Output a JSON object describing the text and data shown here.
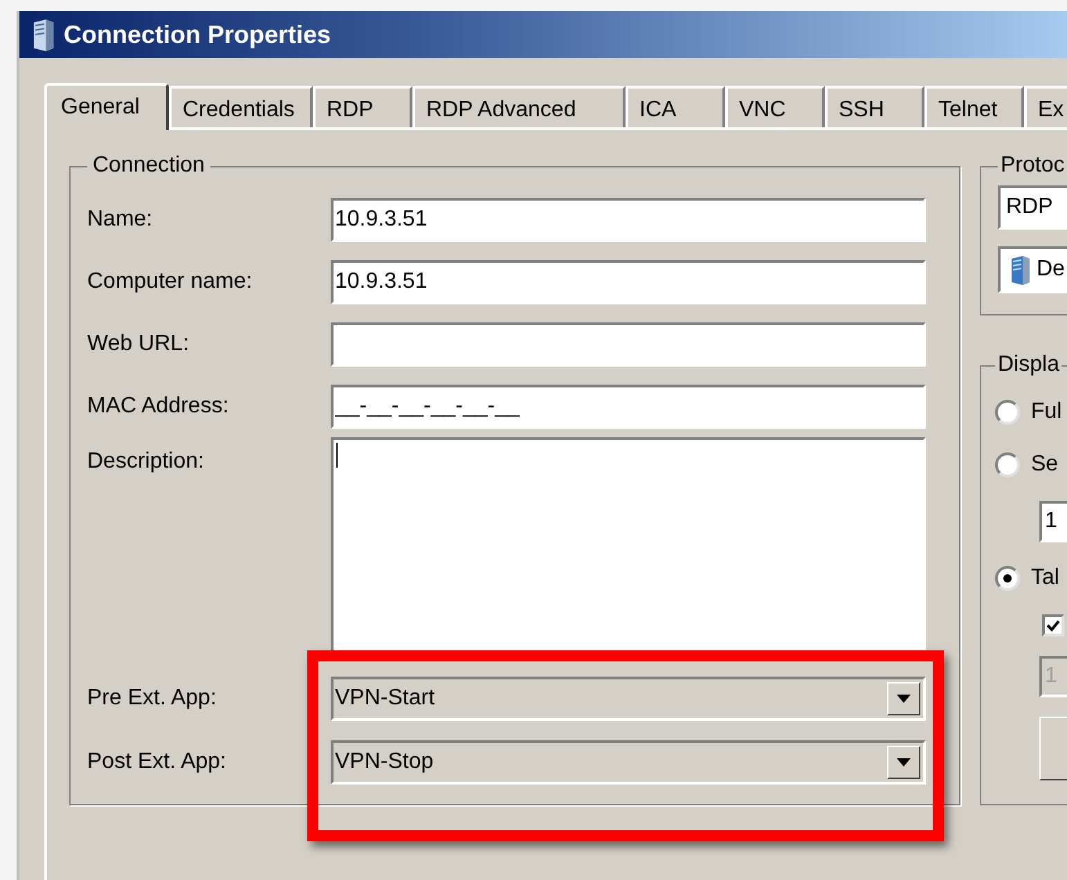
{
  "window": {
    "title": "Connection Properties"
  },
  "tabs": [
    {
      "label": "General",
      "selected": true
    },
    {
      "label": "Credentials",
      "selected": false
    },
    {
      "label": "RDP",
      "selected": false
    },
    {
      "label": "RDP Advanced",
      "selected": false
    },
    {
      "label": "ICA",
      "selected": false
    },
    {
      "label": "VNC",
      "selected": false
    },
    {
      "label": "SSH",
      "selected": false
    },
    {
      "label": "Telnet",
      "selected": false
    },
    {
      "label": "Ex",
      "selected": false
    }
  ],
  "connection": {
    "title": "Connection",
    "fields": [
      {
        "kind": "text",
        "label": "Name:",
        "value": "10.9.3.51"
      },
      {
        "kind": "text",
        "label": "Computer name:",
        "value": "10.9.3.51"
      },
      {
        "kind": "text",
        "label": "Web URL:"
      },
      {
        "kind": "text",
        "label": "MAC Address:",
        "value": "__-__-__-__-__-__"
      },
      {
        "kind": "textarea",
        "label": "Description:",
        "focused": true
      },
      {
        "kind": "combo",
        "label": "Pre Ext. App:",
        "value": "VPN-Start",
        "highlighted": true
      },
      {
        "kind": "combo",
        "label": "Post Ext. App:",
        "value": "VPN-Stop",
        "highlighted": true
      }
    ]
  },
  "protocol": {
    "title": "Protoc",
    "value": "RDP",
    "server": "De"
  },
  "display": {
    "title": "Displa",
    "options": [
      {
        "kind": "radio",
        "label": "Ful",
        "selected": false
      },
      {
        "kind": "radio",
        "label": "Se",
        "selected": false
      },
      {
        "kind": "field",
        "value": "1",
        "disabled": false
      },
      {
        "kind": "radio",
        "label": "Tal",
        "selected": true
      },
      {
        "kind": "checkbox",
        "checked": true
      },
      {
        "kind": "field",
        "value": "1",
        "disabled": true
      },
      {
        "kind": "button"
      }
    ]
  }
}
